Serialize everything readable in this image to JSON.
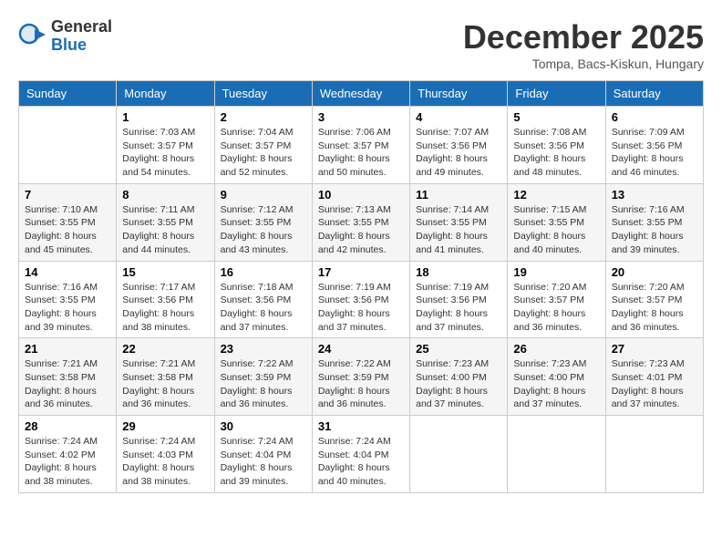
{
  "header": {
    "logo_general": "General",
    "logo_blue": "Blue",
    "title": "December 2025",
    "location": "Tompa, Bacs-Kiskun, Hungary"
  },
  "days_of_week": [
    "Sunday",
    "Monday",
    "Tuesday",
    "Wednesday",
    "Thursday",
    "Friday",
    "Saturday"
  ],
  "weeks": [
    [
      {
        "day": "",
        "info": ""
      },
      {
        "day": "1",
        "info": "Sunrise: 7:03 AM\nSunset: 3:57 PM\nDaylight: 8 hours and 54 minutes."
      },
      {
        "day": "2",
        "info": "Sunrise: 7:04 AM\nSunset: 3:57 PM\nDaylight: 8 hours and 52 minutes."
      },
      {
        "day": "3",
        "info": "Sunrise: 7:06 AM\nSunset: 3:57 PM\nDaylight: 8 hours and 50 minutes."
      },
      {
        "day": "4",
        "info": "Sunrise: 7:07 AM\nSunset: 3:56 PM\nDaylight: 8 hours and 49 minutes."
      },
      {
        "day": "5",
        "info": "Sunrise: 7:08 AM\nSunset: 3:56 PM\nDaylight: 8 hours and 48 minutes."
      },
      {
        "day": "6",
        "info": "Sunrise: 7:09 AM\nSunset: 3:56 PM\nDaylight: 8 hours and 46 minutes."
      }
    ],
    [
      {
        "day": "7",
        "info": "Sunrise: 7:10 AM\nSunset: 3:55 PM\nDaylight: 8 hours and 45 minutes."
      },
      {
        "day": "8",
        "info": "Sunrise: 7:11 AM\nSunset: 3:55 PM\nDaylight: 8 hours and 44 minutes."
      },
      {
        "day": "9",
        "info": "Sunrise: 7:12 AM\nSunset: 3:55 PM\nDaylight: 8 hours and 43 minutes."
      },
      {
        "day": "10",
        "info": "Sunrise: 7:13 AM\nSunset: 3:55 PM\nDaylight: 8 hours and 42 minutes."
      },
      {
        "day": "11",
        "info": "Sunrise: 7:14 AM\nSunset: 3:55 PM\nDaylight: 8 hours and 41 minutes."
      },
      {
        "day": "12",
        "info": "Sunrise: 7:15 AM\nSunset: 3:55 PM\nDaylight: 8 hours and 40 minutes."
      },
      {
        "day": "13",
        "info": "Sunrise: 7:16 AM\nSunset: 3:55 PM\nDaylight: 8 hours and 39 minutes."
      }
    ],
    [
      {
        "day": "14",
        "info": "Sunrise: 7:16 AM\nSunset: 3:55 PM\nDaylight: 8 hours and 39 minutes."
      },
      {
        "day": "15",
        "info": "Sunrise: 7:17 AM\nSunset: 3:56 PM\nDaylight: 8 hours and 38 minutes."
      },
      {
        "day": "16",
        "info": "Sunrise: 7:18 AM\nSunset: 3:56 PM\nDaylight: 8 hours and 37 minutes."
      },
      {
        "day": "17",
        "info": "Sunrise: 7:19 AM\nSunset: 3:56 PM\nDaylight: 8 hours and 37 minutes."
      },
      {
        "day": "18",
        "info": "Sunrise: 7:19 AM\nSunset: 3:56 PM\nDaylight: 8 hours and 37 minutes."
      },
      {
        "day": "19",
        "info": "Sunrise: 7:20 AM\nSunset: 3:57 PM\nDaylight: 8 hours and 36 minutes."
      },
      {
        "day": "20",
        "info": "Sunrise: 7:20 AM\nSunset: 3:57 PM\nDaylight: 8 hours and 36 minutes."
      }
    ],
    [
      {
        "day": "21",
        "info": "Sunrise: 7:21 AM\nSunset: 3:58 PM\nDaylight: 8 hours and 36 minutes."
      },
      {
        "day": "22",
        "info": "Sunrise: 7:21 AM\nSunset: 3:58 PM\nDaylight: 8 hours and 36 minutes."
      },
      {
        "day": "23",
        "info": "Sunrise: 7:22 AM\nSunset: 3:59 PM\nDaylight: 8 hours and 36 minutes."
      },
      {
        "day": "24",
        "info": "Sunrise: 7:22 AM\nSunset: 3:59 PM\nDaylight: 8 hours and 36 minutes."
      },
      {
        "day": "25",
        "info": "Sunrise: 7:23 AM\nSunset: 4:00 PM\nDaylight: 8 hours and 37 minutes."
      },
      {
        "day": "26",
        "info": "Sunrise: 7:23 AM\nSunset: 4:00 PM\nDaylight: 8 hours and 37 minutes."
      },
      {
        "day": "27",
        "info": "Sunrise: 7:23 AM\nSunset: 4:01 PM\nDaylight: 8 hours and 37 minutes."
      }
    ],
    [
      {
        "day": "28",
        "info": "Sunrise: 7:24 AM\nSunset: 4:02 PM\nDaylight: 8 hours and 38 minutes."
      },
      {
        "day": "29",
        "info": "Sunrise: 7:24 AM\nSunset: 4:03 PM\nDaylight: 8 hours and 38 minutes."
      },
      {
        "day": "30",
        "info": "Sunrise: 7:24 AM\nSunset: 4:04 PM\nDaylight: 8 hours and 39 minutes."
      },
      {
        "day": "31",
        "info": "Sunrise: 7:24 AM\nSunset: 4:04 PM\nDaylight: 8 hours and 40 minutes."
      },
      {
        "day": "",
        "info": ""
      },
      {
        "day": "",
        "info": ""
      },
      {
        "day": "",
        "info": ""
      }
    ]
  ]
}
